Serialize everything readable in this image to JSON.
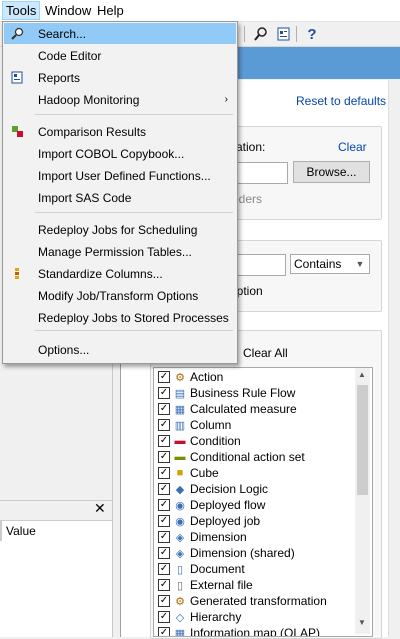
{
  "menubar": {
    "items": [
      "Tools",
      "Window",
      "Help"
    ]
  },
  "toolbar": {
    "icons": [
      "search-icon",
      "report-icon",
      "help-icon"
    ]
  },
  "tools_menu": {
    "items": [
      {
        "label": "Search...",
        "icon": "search-icon"
      },
      {
        "label": "Code Editor",
        "icon": ""
      },
      {
        "label": "Reports",
        "icon": "report-icon"
      },
      {
        "label": "Hadoop Monitoring",
        "icon": "",
        "submenu": "›"
      },
      {
        "label": "Comparison Results",
        "icon": "compare-icon"
      },
      {
        "label": "Import COBOL Copybook...",
        "icon": ""
      },
      {
        "label": "Import User Defined Functions...",
        "icon": ""
      },
      {
        "label": "Import SAS Code",
        "icon": ""
      },
      {
        "label": "Redeploy Jobs for Scheduling",
        "icon": ""
      },
      {
        "label": "Manage Permission Tables...",
        "icon": ""
      },
      {
        "label": "Standardize Columns...",
        "icon": "standardize-icon"
      },
      {
        "label": "Modify Job/Transform Options",
        "icon": ""
      },
      {
        "label": "Redeploy Jobs to Stored Processes",
        "icon": ""
      },
      {
        "label": "Options...",
        "icon": ""
      }
    ]
  },
  "search_panel": {
    "reset_link": "Reset to defaults",
    "location_label": "ation:",
    "clear_link": "Clear",
    "browse_button": "Browse...",
    "subfolders_label": "lders",
    "match_select": "Contains",
    "description_label": "iption",
    "clear_all": "Clear All",
    "types": [
      "Action",
      "Business Rule Flow",
      "Calculated measure",
      "Column",
      "Condition",
      "Conditional action set",
      "Cube",
      "Decision Logic",
      "Deployed flow",
      "Deployed job",
      "Dimension",
      "Dimension (shared)",
      "Document",
      "External file",
      "Generated transformation",
      "Hierarchy",
      "Information map (OLAP)"
    ]
  },
  "properties_pane": {
    "column_value": "Value",
    "close_glyph": "✕"
  },
  "colors": {
    "accent": "#5b9bd5",
    "highlight": "#91c9f7",
    "link": "#0645ad"
  }
}
